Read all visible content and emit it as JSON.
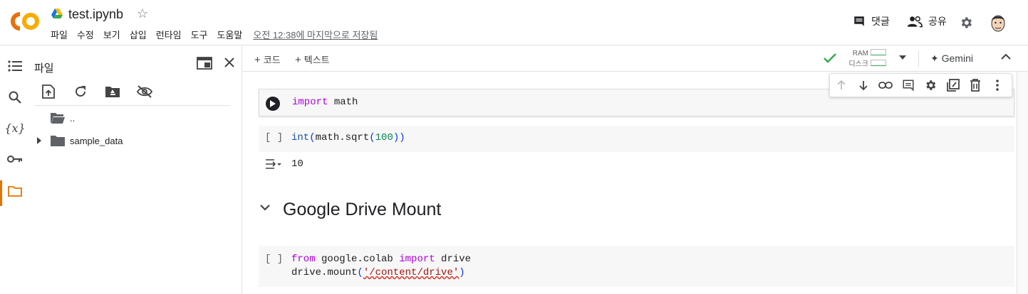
{
  "header": {
    "title": "test.ipynb",
    "menu": [
      "파일",
      "수정",
      "보기",
      "삽입",
      "런타임",
      "도구",
      "도움말"
    ],
    "saved_status": "오전 12:38에 마지막으로 저장됨",
    "comments_label": "댓글",
    "share_label": "공유"
  },
  "file_panel": {
    "title": "파일",
    "tree": [
      {
        "name": ".."
      },
      {
        "name": "sample_data"
      }
    ]
  },
  "toolbar": {
    "add_code": "코드",
    "add_text": "텍스트",
    "ram_label": "RAM",
    "disk_label": "디스크",
    "gemini_label": "Gemini"
  },
  "cells": {
    "cell1": {
      "kw": "import",
      "rest": " math"
    },
    "cell2": {
      "bracket": "[ ]",
      "fn": "int",
      "p1": "(",
      "mid": "math.sqrt",
      "p2": "(",
      "num": "100",
      "p3": "))",
      "output": "10"
    },
    "section_title": "Google Drive Mount",
    "cell3": {
      "bracket": "[ ]",
      "kw_from": "from",
      "module": " google.colab ",
      "kw_import": "import",
      "name": " drive",
      "line2_a": "drive.mount",
      "line2_p1": "(",
      "line2_str": "'/content/drive'",
      "line2_p2": ")"
    }
  },
  "colors": {
    "accent_orange": "#e37400",
    "logo_orange": "#f9ab00",
    "check_green": "#34a853",
    "keyword": "#af00db",
    "string": "#a31515"
  }
}
